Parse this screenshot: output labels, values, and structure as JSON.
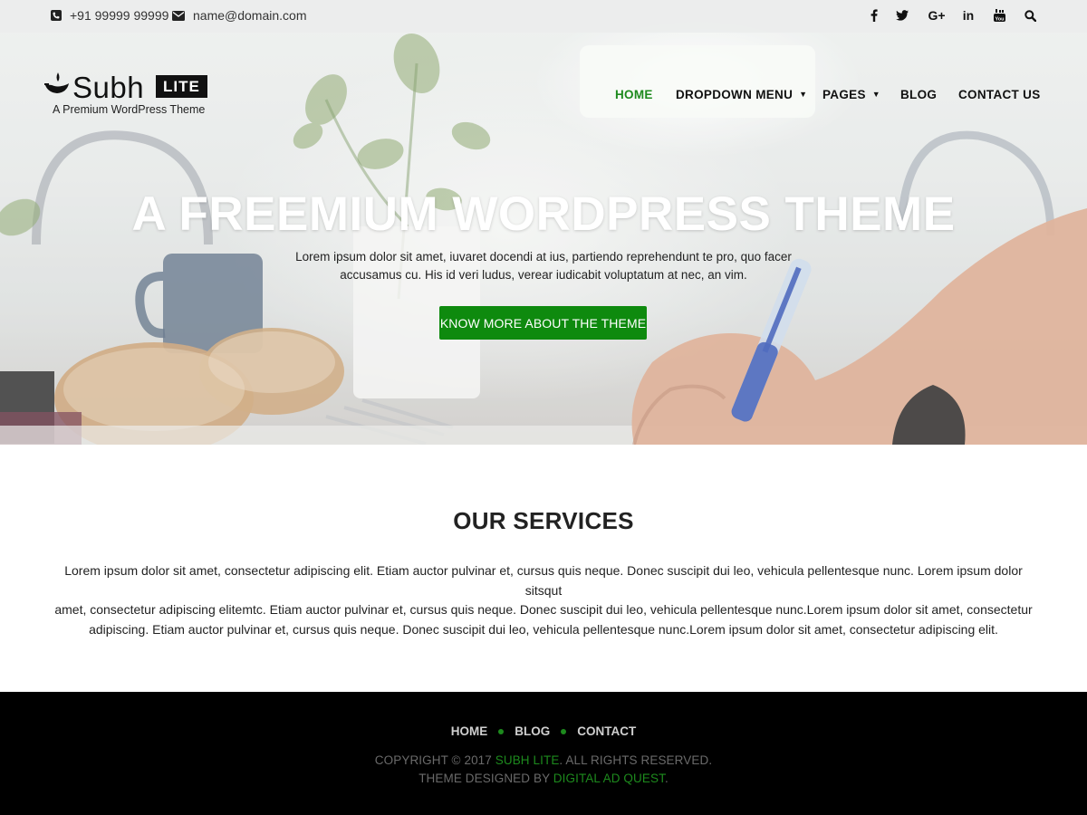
{
  "topbar": {
    "phone": "+91 99999 99999",
    "email": "name@domain.com",
    "social": [
      "facebook-icon",
      "twitter-icon",
      "google-plus-icon",
      "linkedin-icon",
      "youtube-icon",
      "search-icon"
    ],
    "social_glyphs": {
      "facebook": "f",
      "twitter": "t",
      "google": "G+",
      "linkedin": "in",
      "youtube": "▶"
    }
  },
  "logo": {
    "word": "Subh",
    "badge": "LITE",
    "tagline": "A Premium WordPress Theme"
  },
  "nav": {
    "items": [
      "HOME",
      "DROPDOWN MENU",
      "PAGES",
      "BLOG",
      "CONTACT US"
    ],
    "caret": "▼"
  },
  "hero": {
    "title": "A FREEMIUM WORDPRESS THEME",
    "line1": "Lorem ipsum dolor sit amet, iuvaret docendi at ius, partiendo reprehendunt te pro, quo facer",
    "line2": "accusamus cu. His id veri ludus, verear iudicabit voluptatum at nec, an vim.",
    "button": "KNOW MORE ABOUT THE THEME"
  },
  "services": {
    "title": "OUR SERVICES",
    "line1": "Lorem ipsum dolor sit amet, consectetur adipiscing elit. Etiam auctor pulvinar et, cursus quis neque. Donec suscipit dui leo, vehicula pellentesque nunc. Lorem ipsum dolor sitsqut",
    "line2": "amet, consectetur adipiscing elitemtc. Etiam auctor pulvinar et, cursus quis neque. Donec suscipit dui leo, vehicula pellentesque nunc.Lorem ipsum dolor sit amet, consectetur",
    "line3": "adipiscing. Etiam auctor pulvinar et, cursus quis neque. Donec suscipit dui leo, vehicula pellentesque nunc.Lorem ipsum dolor sit amet, consectetur adipiscing elit."
  },
  "footer": {
    "nav": [
      "HOME",
      "BLOG",
      "CONTACT"
    ],
    "copyright_prefix": "COPYRIGHT © 2017 ",
    "copyright_brand": "SUBH LITE",
    "copyright_suffix": ". ALL RIGHTS RESERVED.",
    "designed_prefix": "THEME DESIGNED BY ",
    "designed_brand": "DIGITAL AD QUEST",
    "designed_suffix": "."
  },
  "colors": {
    "accent": "#0e8a0e",
    "footer_bg": "#000000",
    "topbar_bg": "#ecedec"
  }
}
